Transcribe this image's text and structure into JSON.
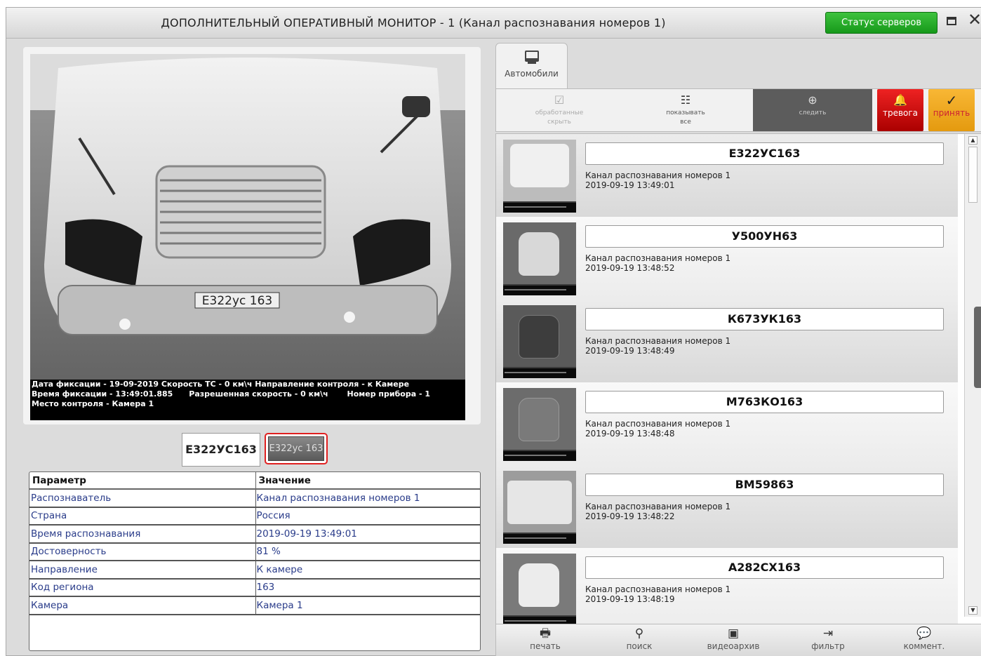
{
  "window": {
    "title": "ДОПОЛНИТЕЛЬНЫЙ ОПЕРАТИВНЫЙ МОНИТОР - 1  (Канал распознавания номеров 1)",
    "status_button": "Статус серверов"
  },
  "video": {
    "overlay_line1": "Дата фиксации - 19-09-2019 Скорость ТС - 0 км\\ч Направление контроля - к Камере",
    "overlay_line2": "Время фиксации - 13:49:01.885      Разрешенная скорость - 0 км\\ч       Номер прибора - 1",
    "overlay_line3": "Место контроля - Камера 1",
    "plate_on_vehicle": "E322ус 163"
  },
  "current_plate": {
    "text": "Е322УС163",
    "image_text": "E322ус 163"
  },
  "params": {
    "header_param": "Параметр",
    "header_value": "Значение",
    "rows": [
      {
        "name": "Распознаватель",
        "value": "Канал распознавания номеров 1"
      },
      {
        "name": "Страна",
        "value": "Россия"
      },
      {
        "name": "Время распознавания",
        "value": "2019-09-19 13:49:01"
      },
      {
        "name": "Достоверность",
        "value": "81 %"
      },
      {
        "name": "Направление",
        "value": "К камере"
      },
      {
        "name": "Код региона",
        "value": "163"
      },
      {
        "name": "Камера",
        "value": "Камера 1"
      }
    ]
  },
  "tab": {
    "label": "Автомобили"
  },
  "toolbar": {
    "hide_processed_line1": "обработанные",
    "hide_processed_line2": "скрыть",
    "show_all_line1": "показывать",
    "show_all_line2": "все",
    "follow": "следить",
    "alarm": "тревога",
    "accept": "принять"
  },
  "list": {
    "items": [
      {
        "plate": "Е322УС163",
        "channel": "Канал распознавания номеров 1",
        "time": "2019-09-19 13:49:01"
      },
      {
        "plate": "У500УН63",
        "channel": "Канал распознавания номеров 1",
        "time": "2019-09-19 13:48:52"
      },
      {
        "plate": "К673УК163",
        "channel": "Канал распознавания номеров 1",
        "time": "2019-09-19 13:48:49"
      },
      {
        "plate": "М763КО163",
        "channel": "Канал распознавания номеров 1",
        "time": "2019-09-19 13:48:48"
      },
      {
        "plate": "ВМ59863",
        "channel": "Канал распознавания номеров 1",
        "time": "2019-09-19 13:48:22"
      },
      {
        "plate": "А282СХ163",
        "channel": "Канал распознавания номеров 1",
        "time": "2019-09-19 13:48:19"
      }
    ]
  },
  "bottom": {
    "print": "печать",
    "search": "поиск",
    "archive": "видеоархив",
    "filter": "фильтр",
    "comment": "коммент."
  },
  "colors": {
    "status_green": "#16991a",
    "alarm_red": "#cc1111",
    "accept_orange": "#f0a820",
    "link_blue": "#2a3c8a",
    "highlight_red": "#e02020"
  },
  "icons": [
    "monitor-icon",
    "checkmark-icon",
    "show-all-icon",
    "target-icon",
    "bell-icon",
    "check-icon",
    "printer-icon",
    "search-icon",
    "archive-icon",
    "filter-icon",
    "comment-icon",
    "maximize-icon",
    "close-icon"
  ]
}
